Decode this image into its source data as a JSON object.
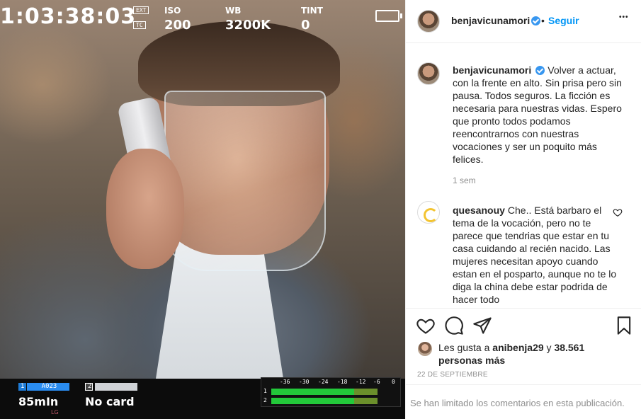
{
  "photo": {
    "timecode": "1:03:38:03",
    "badge_ext": "EXT",
    "badge_tc": "TC",
    "iso_label": "ISO",
    "iso_value": "200",
    "wb_label": "WB",
    "wb_value": "3200K",
    "tint_label": "TINT",
    "tint_value": "0",
    "slot1_num": "1",
    "slot1_name": "A023",
    "slot1_status": "85mIn",
    "slot2_num": "2",
    "slot2_status": "No card",
    "brand": "LG",
    "meter_scale": [
      "-36",
      "-30",
      "-24",
      "-18",
      "-12",
      "-6",
      "0"
    ],
    "meter_channels": [
      "1",
      "2"
    ]
  },
  "header": {
    "username": "benjavicunamori",
    "separator": "•",
    "follow_label": "Seguir",
    "more_label": "•••"
  },
  "caption": {
    "username": "benjavicunamori",
    "text": "Volver a actuar, con la frente en alto. Sin prisa pero sin pausa. Todos seguros. La ficción es necesaria para nuestras vidas. Espero que pronto todos podamos reencontrarnos con nuestras vocaciones y ser un poquito más felices.",
    "time": "1 sem"
  },
  "comment": {
    "username": "quesanouy",
    "text": "Che.. Está barbaro el tema de la vocación, pero no te parece que tendrias que estar en tu casa cuidando al recién nacido. Las mujeres necesitan apoyo cuando estan en el posparto, aunque no te lo diga la china debe estar podrida de hacer todo"
  },
  "actions": {
    "like_icon": "heart-icon",
    "comment_icon": "comment-icon",
    "share_icon": "share-icon",
    "save_icon": "bookmark-icon"
  },
  "likes": {
    "prefix": "Les gusta a",
    "first_user": "anibenja29",
    "connector": "y",
    "others": "38.561 personas más"
  },
  "date": "22 DE SEPTIEMBRE",
  "limited_text": "Se han limitado los comentarios en esta publicación."
}
